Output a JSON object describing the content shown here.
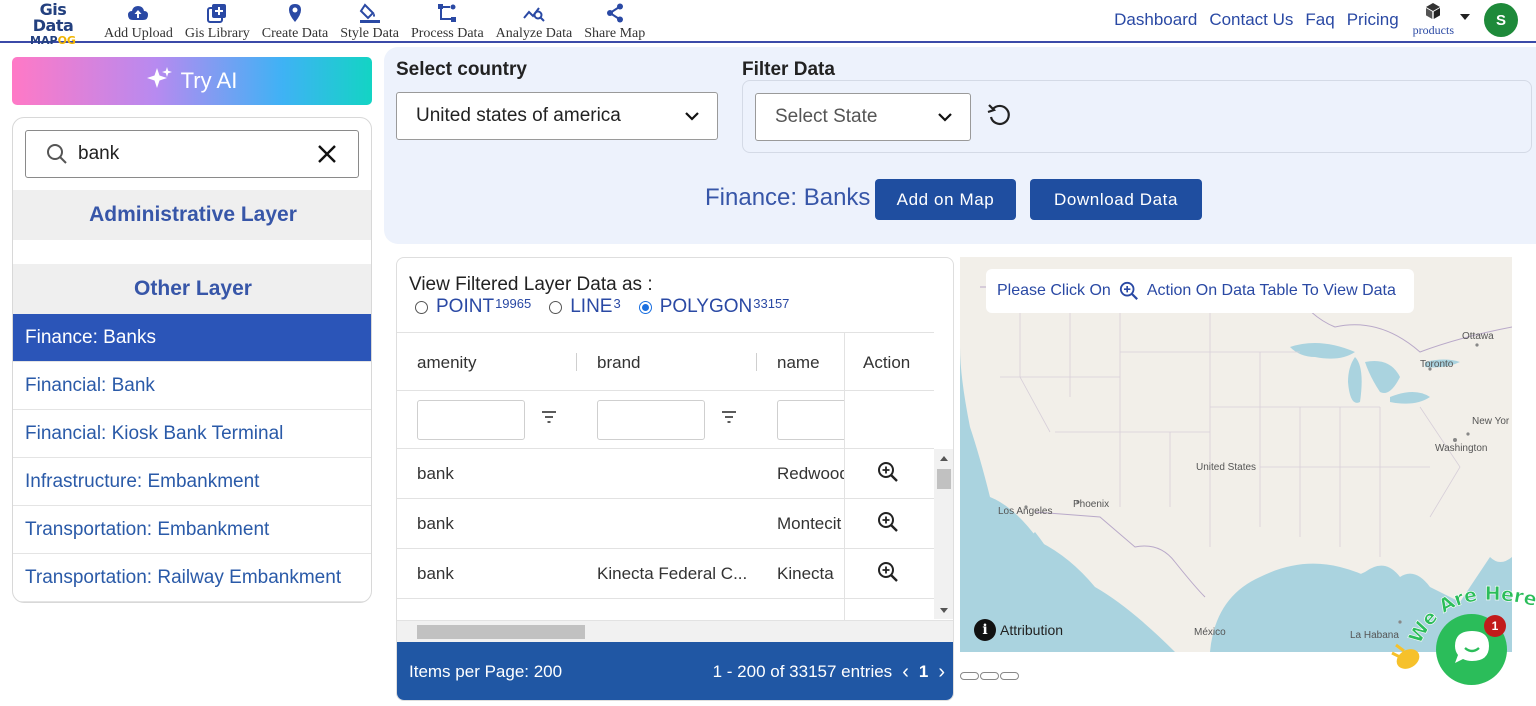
{
  "logo": {
    "line1": "Gis Data",
    "line2_a": "MAP",
    "line2_b": "OG"
  },
  "nav": [
    {
      "label": "Add Upload",
      "icon": "cloud-upload-icon"
    },
    {
      "label": "Gis Library",
      "icon": "library-add-icon"
    },
    {
      "label": "Create Data",
      "icon": "map-pin-icon"
    },
    {
      "label": "Style Data",
      "icon": "paint-bucket-icon"
    },
    {
      "label": "Process Data",
      "icon": "process-nodes-icon"
    },
    {
      "label": "Analyze Data",
      "icon": "analyze-chart-icon"
    },
    {
      "label": "Share Map",
      "icon": "share-icon"
    }
  ],
  "right_nav": {
    "dashboard": "Dashboard",
    "contact": "Contact Us",
    "faq": "Faq",
    "pricing": "Pricing",
    "products": "products",
    "avatar_initial": "S"
  },
  "sidebar": {
    "try_ai": "Try AI",
    "search_value": "bank",
    "admin_layer": "Administrative Layer",
    "other_layer": "Other Layer",
    "items": [
      "Finance: Banks",
      "Financial: Bank",
      "Financial: Kiosk Bank Terminal",
      "Infrastructure: Embankment",
      "Transportation: Embankment",
      "Transportation: Railway Embankment"
    ],
    "active_index": 0
  },
  "filters": {
    "country_label": "Select country",
    "country_value": "United states of america",
    "filter_label": "Filter Data",
    "state_placeholder": "Select State",
    "layer_title": "Finance: Banks",
    "add_button": "Add on Map",
    "download_button": "Download Data"
  },
  "table": {
    "view_as": "View Filtered Layer Data as :",
    "geometry": [
      {
        "label": "POINT",
        "count": "19965",
        "selected": false
      },
      {
        "label": "LINE",
        "count": "3",
        "selected": false
      },
      {
        "label": "POLYGON",
        "count": "33157",
        "selected": true
      }
    ],
    "columns": [
      "amenity",
      "brand",
      "name",
      "Action"
    ],
    "rows": [
      {
        "amenity": "bank",
        "brand": "",
        "name": "Redwood"
      },
      {
        "amenity": "bank",
        "brand": "",
        "name": "Montecit"
      },
      {
        "amenity": "bank",
        "brand": "Kinecta Federal C...",
        "name": "Kinecta"
      }
    ],
    "items_per_page": "Items per Page: 200",
    "range": "1 - 200 of 33157 entries",
    "current_page": "1"
  },
  "map": {
    "note_before": "Please Click On",
    "note_after": "Action On Data Table To View Data",
    "labels": {
      "ottawa": "Ottawa",
      "toronto": "Toronto",
      "new_york": "New Yor",
      "washington": "Washington",
      "united_states": "United States",
      "phoenix": "Phoenix",
      "los_angeles": "Los Angeles",
      "mexico": "México",
      "la_habana": "La Habana"
    },
    "attribution": "Attribution",
    "attribution_icon": "i"
  },
  "chat": {
    "banner": "We Are Here!",
    "badge": "1"
  },
  "colors": {
    "brand_blue": "#1f4ea0",
    "active_item": "#2b55b8",
    "chat_green": "#2bbd5a"
  }
}
